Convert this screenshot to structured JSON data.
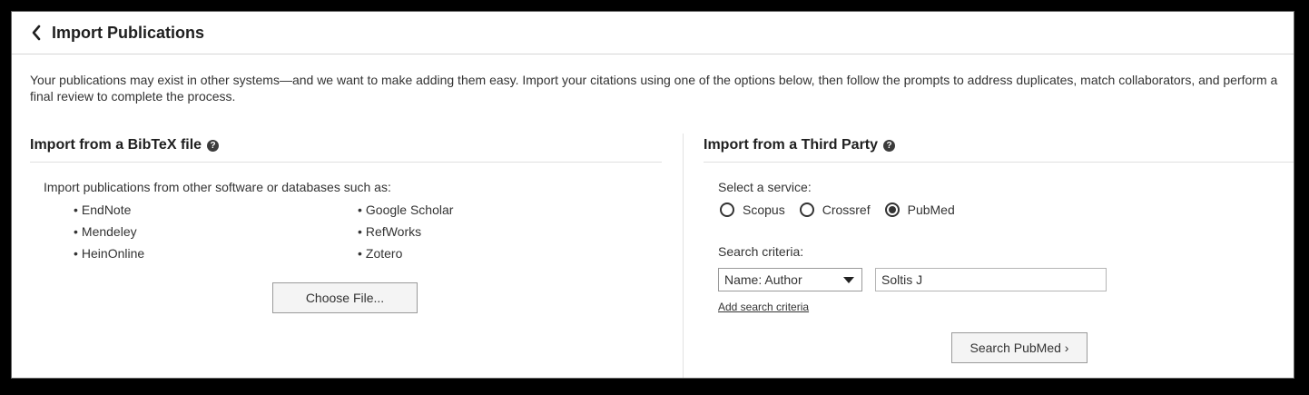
{
  "header": {
    "title": "Import Publications"
  },
  "intro": "Your publications may exist in other systems—and we want to make adding them easy. Import your citations using one of the options below, then follow the prompts to address duplicates, match collaborators, and perform a final review to complete the process.",
  "bibtex": {
    "title": "Import from a BibTeX file",
    "description": "Import publications from other software or databases such as:",
    "sources_left": [
      "EndNote",
      "Mendeley",
      "HeinOnline"
    ],
    "sources_right": [
      "Google Scholar",
      "RefWorks",
      "Zotero"
    ],
    "choose_file_label": "Choose File..."
  },
  "third_party": {
    "title": "Import from a Third Party",
    "service_label": "Select a service:",
    "services": [
      "Scopus",
      "Crossref",
      "PubMed"
    ],
    "selected_service": "PubMed",
    "criteria_label": "Search criteria:",
    "criteria_select_value": "Name: Author",
    "criteria_input_value": "Soltis J",
    "add_criteria_link": "Add search criteria",
    "search_button_label": "Search PubMed ›"
  }
}
